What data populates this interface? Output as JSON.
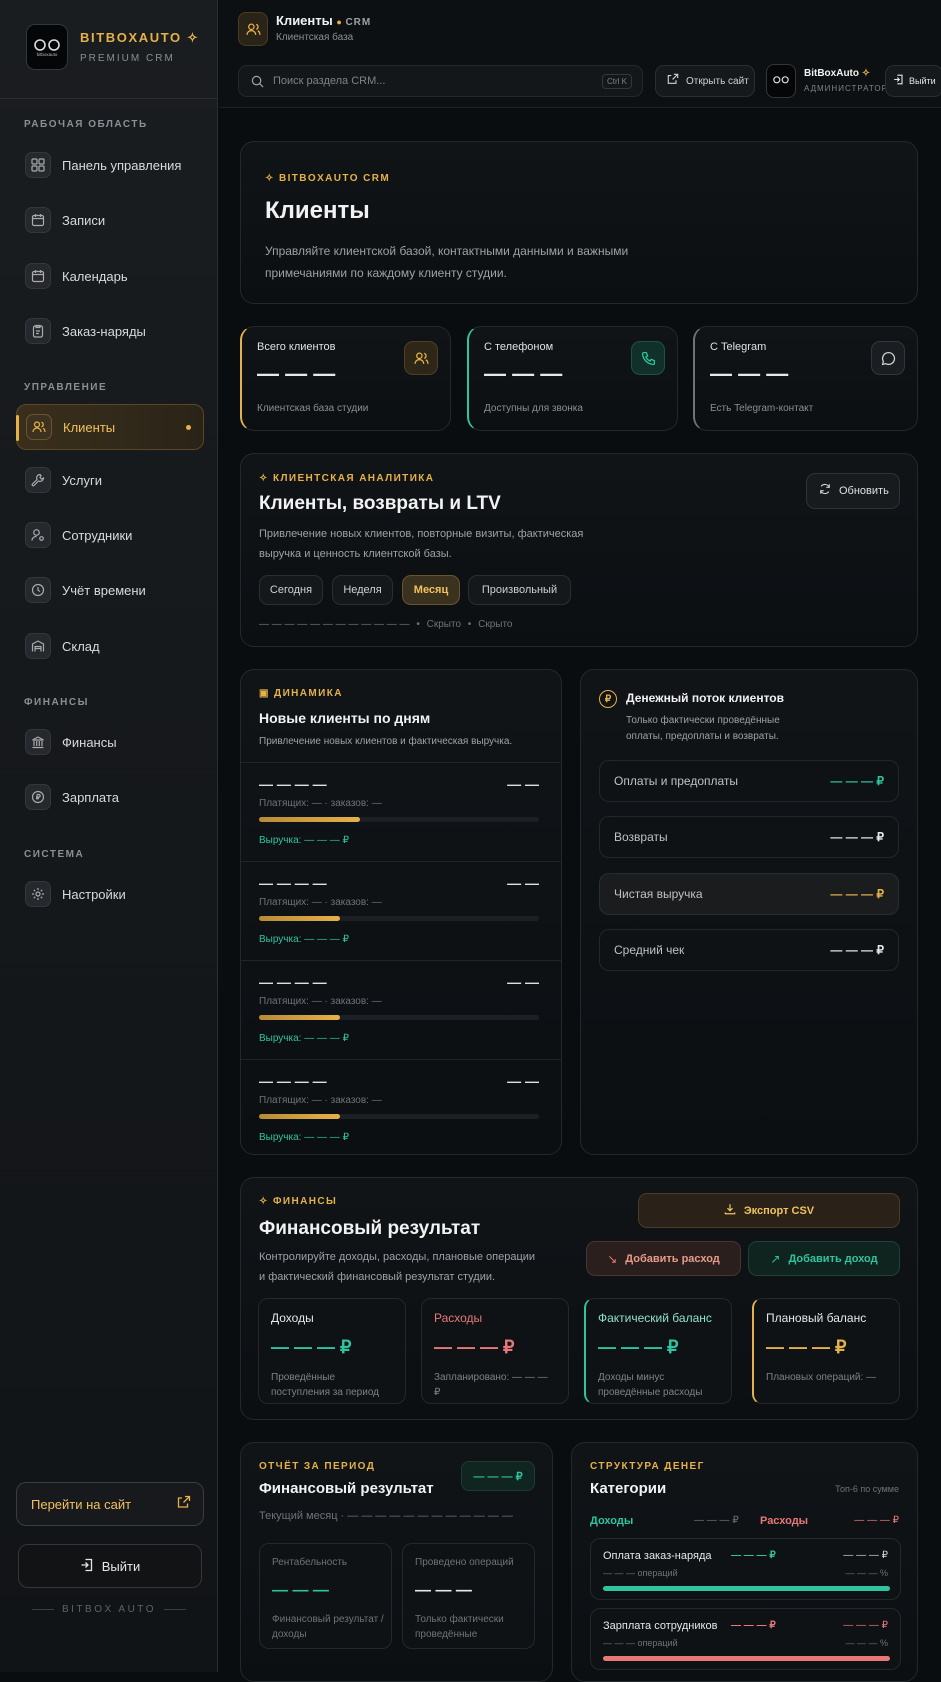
{
  "sidebar": {
    "brand": "BITBOXAUTO",
    "brand_sub": "PREMIUM CRM",
    "logo_text": "bitboxauto",
    "sections": {
      "workspace": "РАБОЧАЯ ОБЛАСТЬ",
      "management": "УПРАВЛЕНИЕ",
      "finance": "ФИНАНСЫ",
      "system": "СИСТЕМА"
    },
    "items": {
      "dashboard": "Панель управления",
      "records": "Записи",
      "calendar": "Календарь",
      "orders": "Заказ-наряды",
      "clients": "Клиенты",
      "services": "Услуги",
      "staff": "Сотрудники",
      "time": "Учёт времени",
      "warehouse": "Склад",
      "finance": "Финансы",
      "salary": "Зарплата",
      "settings": "Настройки"
    },
    "go_site": "Перейти на сайт",
    "logout": "Выйти",
    "footer": "BITBOX AUTO"
  },
  "header": {
    "title": "Клиенты",
    "crm": "CRM",
    "subtitle": "Клиентская база",
    "search_placeholder": "Поиск раздела CRM...",
    "search_hotkey": "Ctrl K",
    "open_site": "Открыть сайт",
    "user_name": "BitBoxAuto",
    "user_role": "АДМИНИСТРАТОР",
    "logout": "Выйти"
  },
  "hero": {
    "kicker": "BITBOXAUTO CRM",
    "title": "Клиенты",
    "desc_line1": "Управляйте клиентской базой, контактными данными и важными",
    "desc_line2": "примечаниями по каждому клиенту студии."
  },
  "stats": [
    {
      "label": "Всего клиентов",
      "value": "— — —",
      "sub": "Клиентская база студии",
      "accent": "#e5b14a"
    },
    {
      "label": "С телефоном",
      "value": "— — —",
      "sub": "Доступны для звонка",
      "accent": "#2ec4a0"
    },
    {
      "label": "С Telegram",
      "value": "— — —",
      "sub": "Есть Telegram-контакт",
      "accent": "#8b8e92"
    }
  ],
  "analytics": {
    "kicker": "КЛИЕНТСКАЯ АНАЛИТИКА",
    "title": "Клиенты, возвраты и LTV",
    "desc_line1": "Привлечение новых клиентов, повторные визиты, фактическая",
    "desc_line2": "выручка и ценность клиентской базы.",
    "refresh": "Обновить",
    "periods": [
      "Сегодня",
      "Неделя",
      "Месяц",
      "Произвольный"
    ],
    "active_period": "Месяц",
    "range": "— — — — —  —  — — — — — —",
    "hidden1": "Скрыто",
    "hidden2": "Скрыто"
  },
  "dynamics": {
    "kicker": "ДИНАМИКА",
    "title": "Новые клиенты по дням",
    "desc": "Привлечение новых клиентов и фактическая выручка.",
    "rows": [
      {
        "date": "— — — —",
        "count": "— —",
        "meta_payers": "Платящих: —",
        "meta_orders": "заказов: —",
        "revenue_label": "Выручка:",
        "revenue": "— — — ₽",
        "fill": 0.36
      },
      {
        "date": "— — — —",
        "count": "— —",
        "meta_payers": "Платящих: —",
        "meta_orders": "заказов: —",
        "revenue_label": "Выручка:",
        "revenue": "— — — ₽",
        "fill": 0.29
      },
      {
        "date": "— — — —",
        "count": "— —",
        "meta_payers": "Платящих: —",
        "meta_orders": "заказов: —",
        "revenue_label": "Выручка:",
        "revenue": "— — — ₽",
        "fill": 0.29
      },
      {
        "date": "— — — —",
        "count": "— —",
        "meta_payers": "Платящих: —",
        "meta_orders": "заказов: —",
        "revenue_label": "Выручка:",
        "revenue": "— — — ₽",
        "fill": 0.29
      }
    ]
  },
  "cashflow": {
    "title": "Денежный поток клиентов",
    "desc_line1": "Только фактически проведённые",
    "desc_line2": "оплаты, предоплаты и возвраты.",
    "items": [
      {
        "label": "Оплаты и предоплаты",
        "value": "— — — ₽",
        "color": "#2ec4a0"
      },
      {
        "label": "Возвраты",
        "value": "— — — ₽",
        "color": "#e8e8e8"
      },
      {
        "label": "Чистая выручка",
        "value": "— — — ₽",
        "color": "#e5b14a"
      },
      {
        "label": "Средний чек",
        "value": "— — — ₽",
        "color": "#e8e8e8"
      }
    ]
  },
  "finance": {
    "kicker": "ФИНАНСЫ",
    "title": "Финансовый результат",
    "desc_line1": "Контролируйте доходы, расходы, плановые операции",
    "desc_line2": "и фактический финансовый результат студии.",
    "export": "Экспорт CSV",
    "add_expense": "Добавить расход",
    "add_income": "Добавить доход",
    "cards": [
      {
        "label": "Доходы",
        "value": "— — — ₽",
        "sub": "Проведённые поступления за период",
        "color": "#2ec4a0",
        "label_color": "#e8e8e8"
      },
      {
        "label": "Расходы",
        "value": "— — — ₽",
        "sub": "Запланировано: — — — ₽",
        "color": "#e87878",
        "label_color": "#e87878"
      },
      {
        "label": "Фактический баланс",
        "value": "— — — ₽",
        "sub": "Доходы минус проведённые расходы",
        "color": "#2ec4a0",
        "label_color": "#8fe0cc"
      },
      {
        "label": "Плановый баланс",
        "value": "— — — ₽",
        "sub": "Плановых операций: —",
        "color": "#e5b14a",
        "label_color": "#e8e8e8"
      }
    ]
  },
  "report": {
    "kicker": "ОТЧЁТ ЗА ПЕРИОД",
    "title": "Финансовый результат",
    "badge": "— — — ₽",
    "period": "Текущий месяц · — — — — — —  — — — — — —",
    "boxes": [
      {
        "label": "Рентабельность",
        "value": "— — —",
        "sub": "Финансовый результат / доходы"
      },
      {
        "label": "Проведено операций",
        "value": "— — —",
        "sub": "Только фактически проведённые"
      }
    ]
  },
  "structure": {
    "kicker": "СТРУКТУРА ДЕНЕГ",
    "title": "Категории",
    "top": "Топ-6 по сумме",
    "income_label": "Доходы",
    "income_value": "— — — ₽",
    "expense_label": "Расходы",
    "expense_value": "— — — ₽",
    "rows": [
      {
        "name": "Оплата заказ-наряда",
        "amount": "— — — ₽",
        "right": "— — — ₽",
        "ops": "— — — операций",
        "pct": "— — — %",
        "color": "#2ec4a0"
      },
      {
        "name": "Зарплата сотрудников",
        "amount": "— — — ₽",
        "right": "— — — ₽",
        "ops": "— — — операций",
        "pct": "— — — %",
        "color": "#e87878"
      }
    ]
  },
  "colors": {
    "accent": "#e5b14a",
    "green": "#2ec4a0",
    "red": "#e87878"
  }
}
